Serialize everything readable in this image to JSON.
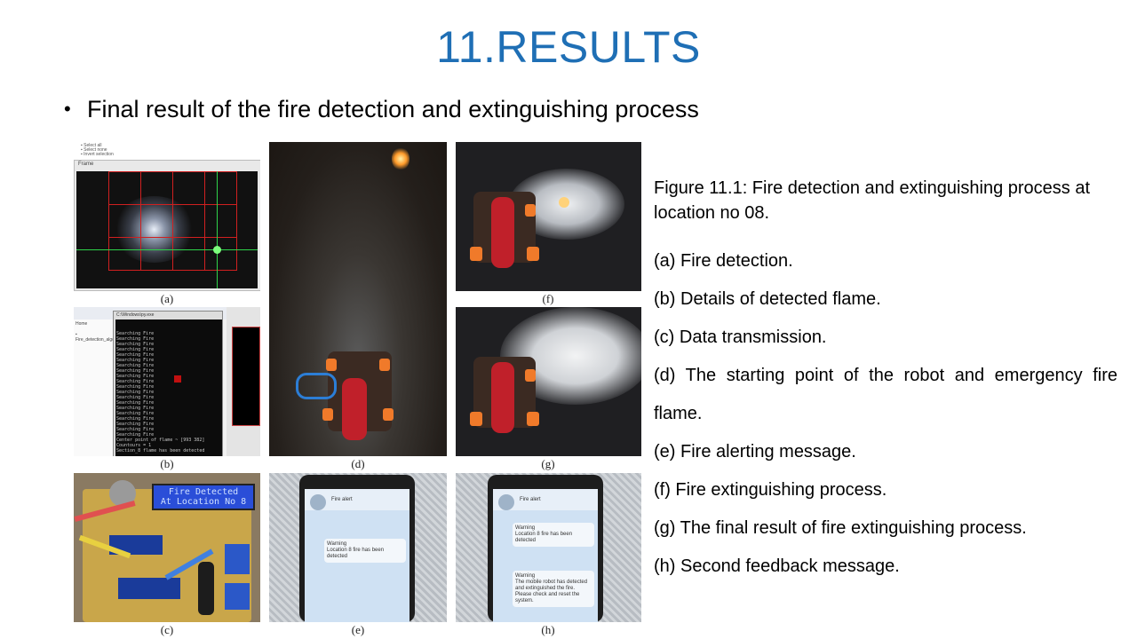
{
  "slide": {
    "title": "11.RESULTS",
    "bullet": "Final result of the fire detection and extinguishing process"
  },
  "panels": {
    "a": "(a)",
    "b": "(b)",
    "c": "(c)",
    "d": "(d)",
    "e": "(e)",
    "f": "(f)",
    "g": "(g)",
    "h": "(h)"
  },
  "panel_text": {
    "lcd_line1": "Fire Detected",
    "lcd_line2": "At Location No 8",
    "console_line": "Searching Fire",
    "console_center": "Center point of flame ~ [993 382]",
    "console_counter": "Countours = 1",
    "console_detected": "Section_8 flame has been detected",
    "phone_title": "Fire alert",
    "msg1": "Warning\nLocation 8 fire has been detected",
    "msg2": "Warning\nThe mobile robot has detected and extinguished the fire. Please check and reset the system."
  },
  "caption": {
    "figure": "Figure 11.1: Fire detection and extinguishing process at location no 08.",
    "items": [
      "(a) Fire detection.",
      "(b) Details of detected flame.",
      "(c) Data transmission.",
      "(d) The starting point of the robot and emergency fire",
      "flame.",
      "(e) Fire alerting message.",
      "(f) Fire extinguishing process.",
      "(g) The final result of fire extinguishing process.",
      "(h) Second feedback message."
    ]
  },
  "colors": {
    "title": "#1f6fb5"
  }
}
